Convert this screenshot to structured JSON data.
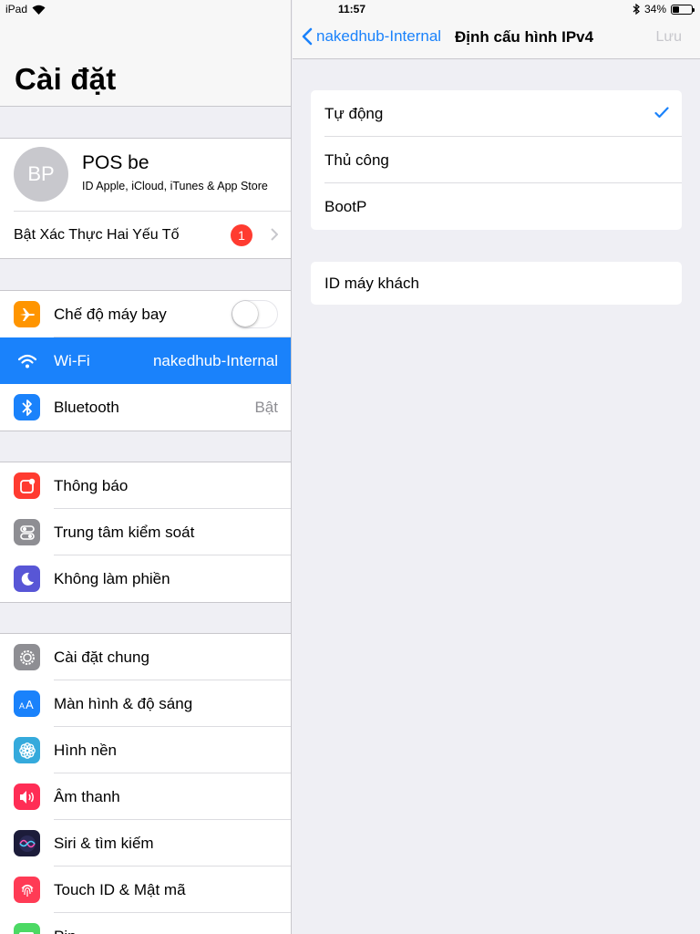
{
  "status_bar": {
    "device": "iPad",
    "time": "11:57",
    "battery": "34%",
    "battery_level": 0.34
  },
  "left_pane": {
    "title": "Cài đặt",
    "profile": {
      "initials": "BP",
      "name": "POS be",
      "subtitle": "ID Apple, iCloud, iTunes & App Store"
    },
    "two_factor": {
      "label": "Bật Xác Thực Hai Yếu Tố",
      "badge": "1"
    },
    "connectivity": [
      {
        "label": "Chế độ máy bay",
        "icon": "airplane-icon",
        "color": "#ff9500",
        "toggle": false
      },
      {
        "label": "Wi-Fi",
        "icon": "wifi-icon",
        "color": "#1a82fb",
        "value": "nakedhub-Internal",
        "selected": true
      },
      {
        "label": "Bluetooth",
        "icon": "bluetooth-icon",
        "color": "#1a82fb",
        "value": "Bật"
      }
    ],
    "notifications_group": [
      {
        "label": "Thông báo",
        "icon": "notifications-icon",
        "color": "#ff3b30"
      },
      {
        "label": "Trung tâm kiểm soát",
        "icon": "control-center-icon",
        "color": "#8e8e93"
      },
      {
        "label": "Không làm phiền",
        "icon": "moon-icon",
        "color": "#5856d6"
      }
    ],
    "general_group": [
      {
        "label": "Cài đặt chung",
        "icon": "gear-icon",
        "color": "#8e8e93"
      },
      {
        "label": "Màn hình & độ sáng",
        "icon": "display-brightness-icon",
        "color": "#1a82fb"
      },
      {
        "label": "Hình nền",
        "icon": "wallpaper-icon",
        "color": "#35aadc"
      },
      {
        "label": "Âm thanh",
        "icon": "speaker-icon",
        "color": "#ff2d55"
      },
      {
        "label": "Siri & tìm kiếm",
        "icon": "siri-icon",
        "color": "#1c1c3a"
      },
      {
        "label": "Touch ID & Mật mã",
        "icon": "fingerprint-icon",
        "color": "#ff3b55"
      },
      {
        "label": "Pin",
        "icon": "battery-icon",
        "color": "#4cd964"
      }
    ]
  },
  "right_pane": {
    "back_label": "nakedhub-Internal",
    "title": "Định cấu hình IPv4",
    "save_label": "Lưu",
    "options": [
      {
        "label": "Tự động",
        "checked": true
      },
      {
        "label": "Thủ công",
        "checked": false
      },
      {
        "label": "BootP",
        "checked": false
      }
    ],
    "client_id_label": "ID máy khách"
  }
}
